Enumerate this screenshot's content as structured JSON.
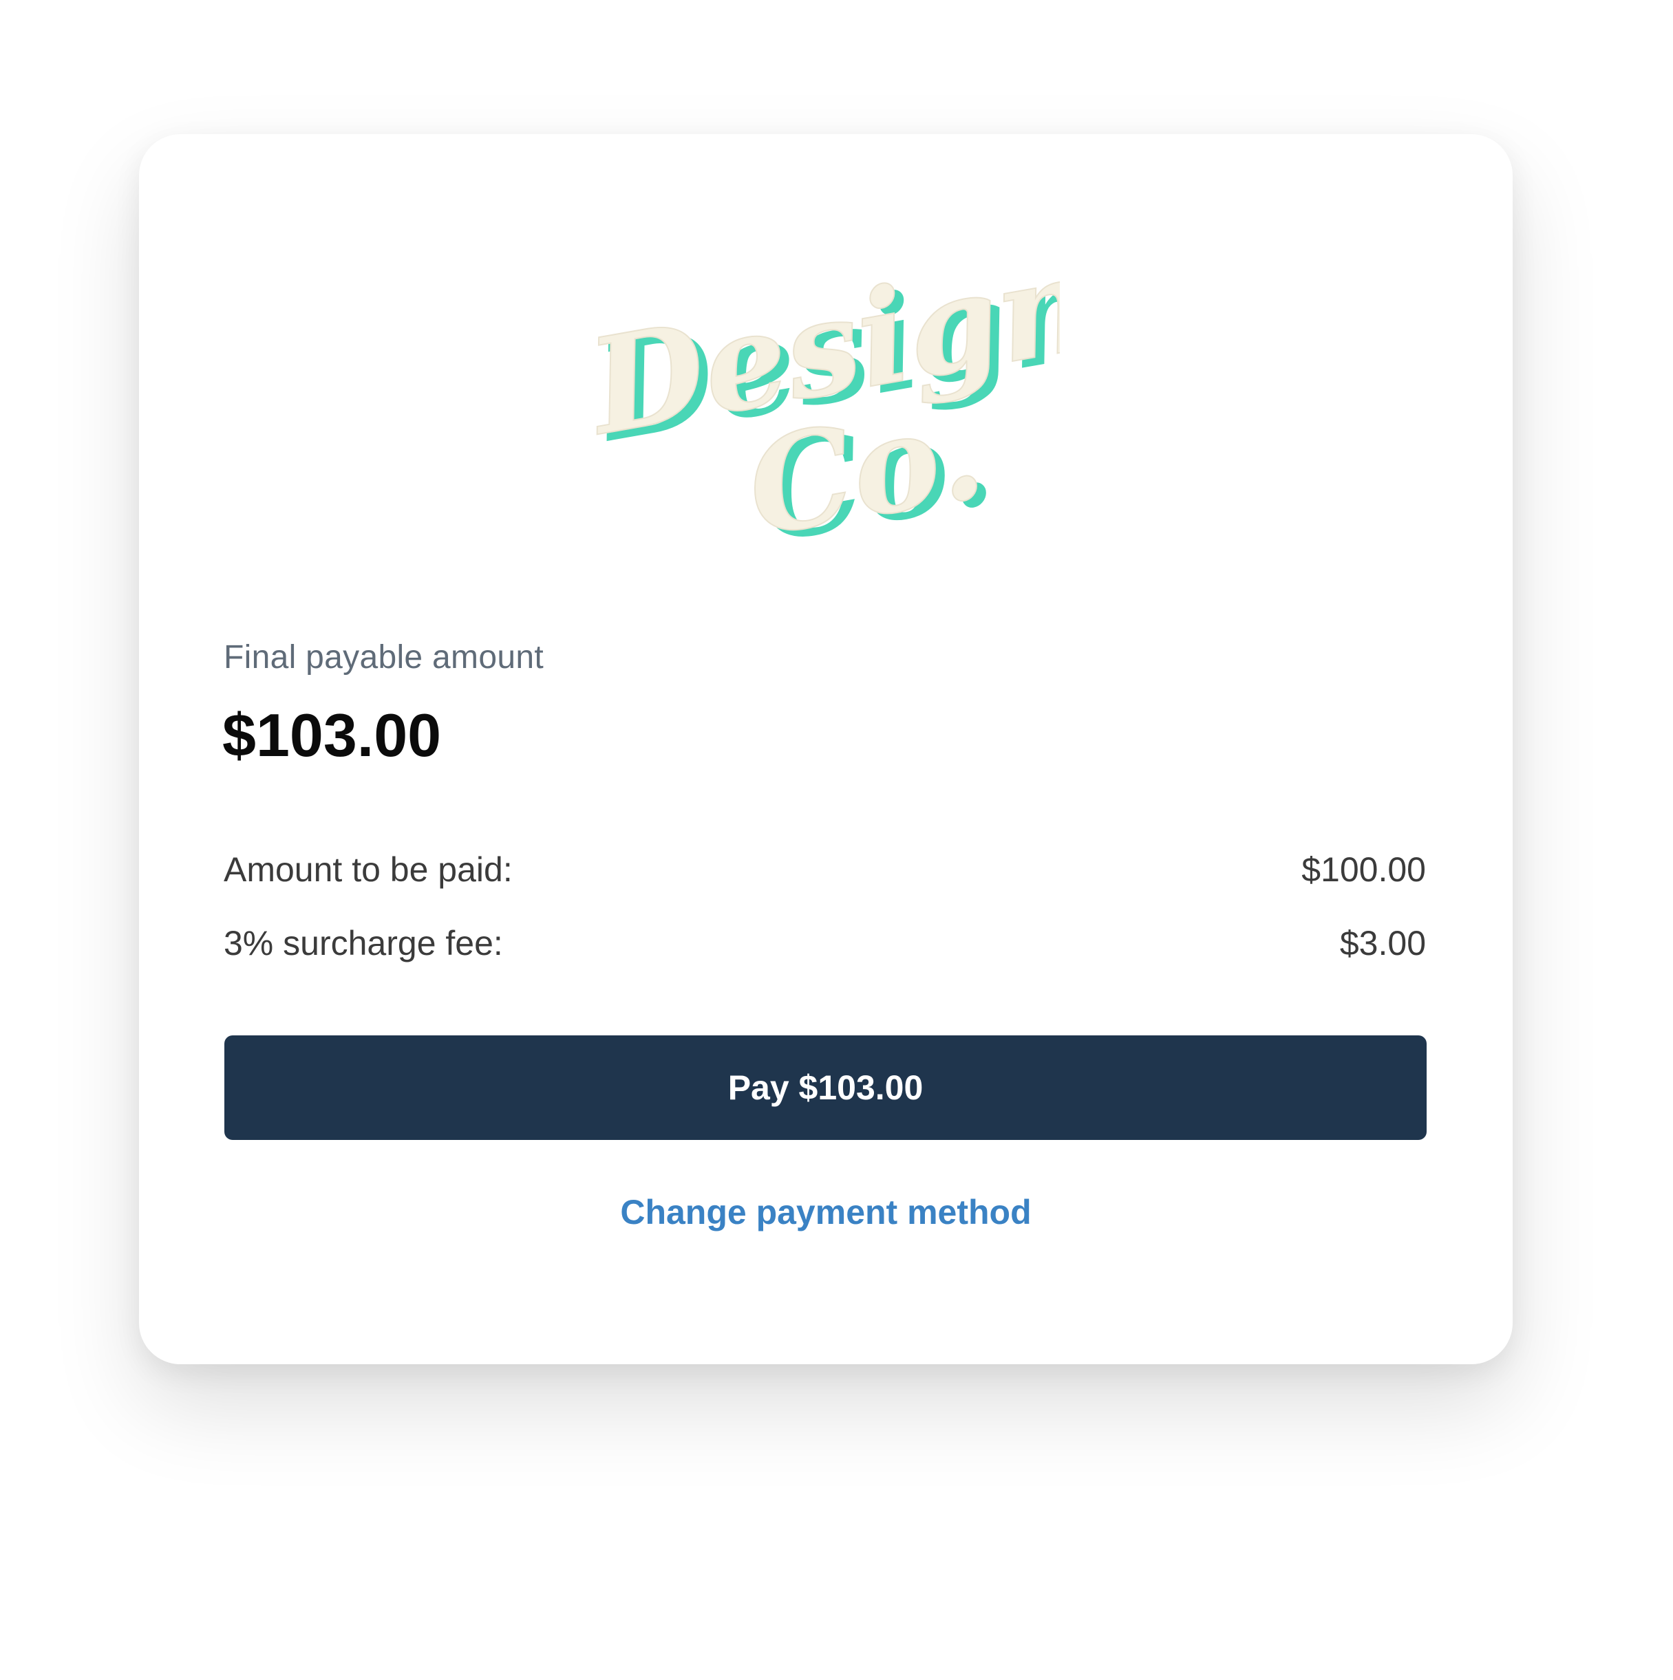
{
  "brand": {
    "logo_line1": "Design",
    "logo_line2": "Co.",
    "logo_fill_color": "#f6f1e2",
    "logo_shadow_color": "#49d6b6"
  },
  "summary": {
    "final_label": "Final payable amount",
    "final_amount": "$103.00"
  },
  "breakdown": [
    {
      "label": "Amount to be paid:",
      "value": "$100.00"
    },
    {
      "label": "3% surcharge fee:",
      "value": "$3.00"
    }
  ],
  "actions": {
    "pay_label": "Pay $103.00",
    "change_method_label": "Change payment method"
  },
  "colors": {
    "button_bg": "#1f354d",
    "link": "#3a82c4"
  }
}
